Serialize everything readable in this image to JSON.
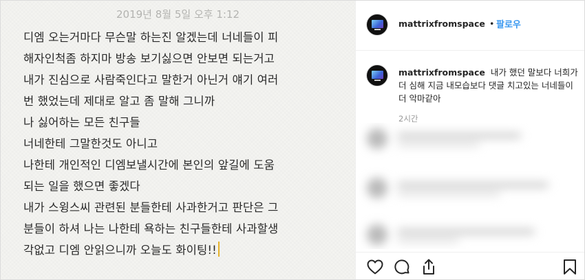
{
  "note": {
    "date": "2019년 8월 5일 오후 1:12",
    "lines": [
      "디엠 오는거마다 무슨말 하는진 알겠는데 너네들이 피",
      "해자인척좀 하지마 방송 보기싫으면 안보면 되는거고",
      "내가 진심으로 사람죽인다고 말한거 아닌거 얘기 여러",
      "번 했었는데 제대로 알고 좀 말해 그니까",
      "나 싫어하는 모든 친구들",
      "너네한테 그말한것도 아니고",
      "나한테 개인적인 디엠보낼시간에 본인의 앞길에 도움",
      "되는 일을 했으면 좋겠다",
      "내가 스윙스씨 관련된 분들한테 사과한거고 판단은 그",
      "분들이 하셔 나는 나한테 욕하는 친구들한테 사과할생",
      "각없고 디엠 안읽으니까 오늘도 화이팅!!"
    ]
  },
  "header": {
    "username": "mattrixfromspace",
    "separator": "•",
    "follow_label": "팔로우"
  },
  "caption": {
    "username": "mattrixfromspace",
    "text": "내가 했던 말보다 너희가 더 심해 지금 내모습보다 댓글 치고있는 너네들이 더 악마같아",
    "time": "2시간"
  },
  "icons": {
    "like": "heart-icon",
    "comment": "comment-icon",
    "share": "share-icon",
    "save": "bookmark-icon",
    "avatar": "computer-monitor-avatar"
  },
  "colors": {
    "accent": "#3897f0",
    "text": "#262626",
    "muted": "#999999",
    "cursor": "#e6b32a"
  }
}
